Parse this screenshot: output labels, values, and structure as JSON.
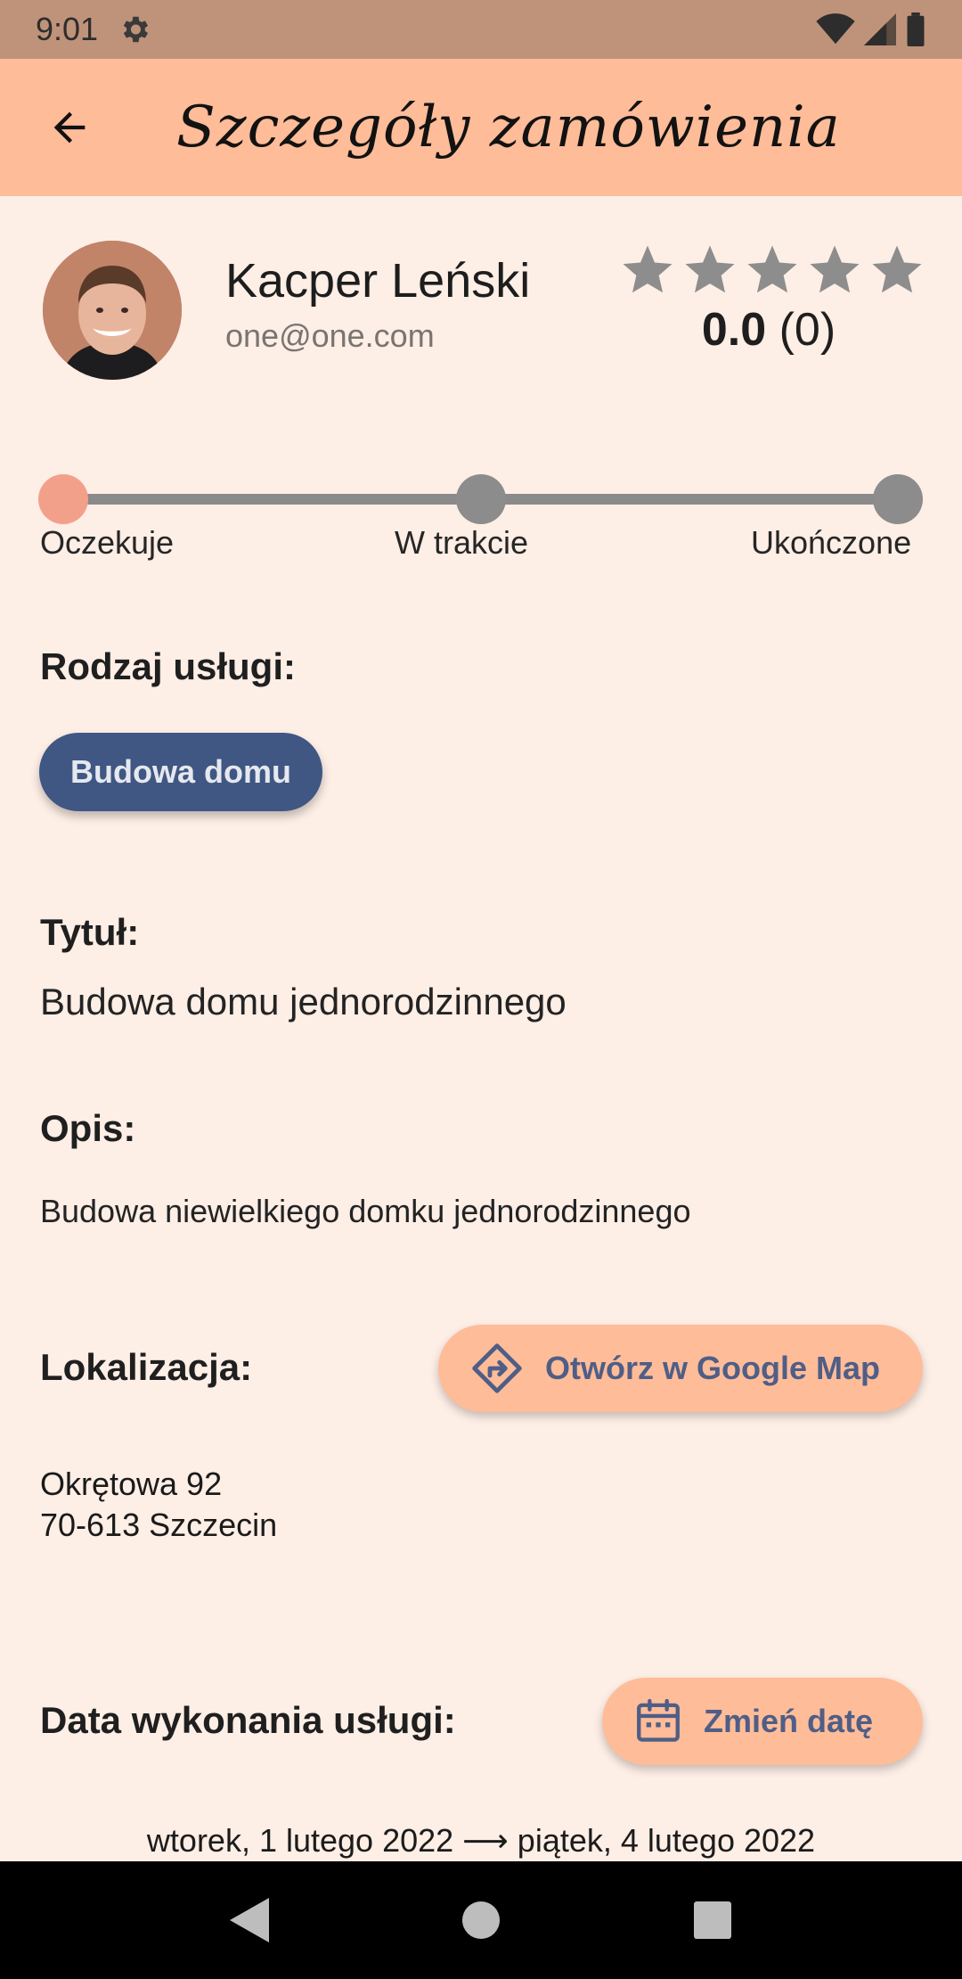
{
  "status_bar": {
    "time": "9:01"
  },
  "app_bar": {
    "title": "Szczegóły zamówienia"
  },
  "profile": {
    "name": "Kacper Leński",
    "email": "one@one.com",
    "rating_score": "0.0",
    "rating_count": "(0)",
    "stars_filled": 0,
    "stars_total": 5
  },
  "progress": {
    "steps": [
      "Oczekuje",
      "W trakcie",
      "Ukończone"
    ],
    "current_step": 0
  },
  "service": {
    "label": "Rodzaj usługi:",
    "type": "Budowa domu"
  },
  "title_section": {
    "label": "Tytuł:",
    "value": "Budowa domu jednorodzinnego"
  },
  "description_section": {
    "label": "Opis:",
    "value": "Budowa niewielkiego domku jednorodzinnego"
  },
  "location": {
    "label": "Lokalizacja:",
    "map_button": "Otwórz w Google Map",
    "street": "Okrętowa 92",
    "city": "70-613 Szczecin"
  },
  "date_section": {
    "label": "Data wykonania usługi:",
    "change_button": "Zmień datę",
    "start": "wtorek, 1 lutego 2022",
    "arrow": "⟶",
    "end": "piątek, 4 lutego 2022"
  },
  "colors": {
    "status_bar": "#bf937a",
    "app_bar": "#ffbc98",
    "background": "#fdeee6",
    "chip": "#3f5782",
    "button_text": "#4f5e86",
    "step_active": "#f3a08b",
    "step_inactive": "#8c8c8c"
  }
}
